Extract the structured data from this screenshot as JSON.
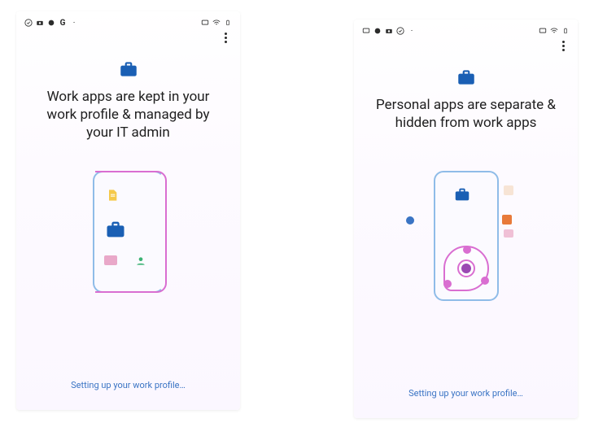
{
  "accent_blue": "#1a5fb4",
  "accent_pink": "#d96ed1",
  "left_screen": {
    "title": "Work apps are kept in your work profile & managed by your IT admin",
    "footer_status": "Setting up your work profile…"
  },
  "right_screen": {
    "title": "Personal apps are separate & hidden from work apps",
    "footer_status": "Setting up your work profile…"
  },
  "icons": {
    "briefcase": "briefcase-icon",
    "doc_yellow": "document-icon",
    "person_green": "person-icon",
    "kebab": "more-vert-icon"
  }
}
